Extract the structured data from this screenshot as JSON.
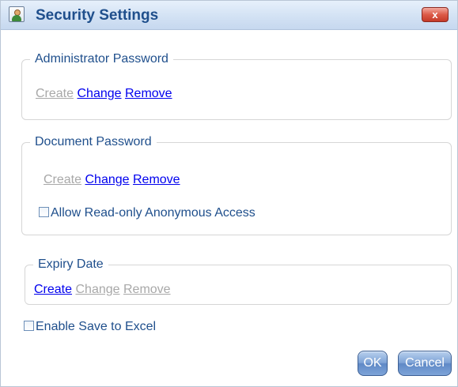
{
  "window": {
    "title": "Security Settings",
    "close_label": "x"
  },
  "admin_password": {
    "legend": "Administrator Password",
    "create": "Create",
    "change": "Change",
    "remove": "Remove"
  },
  "document_password": {
    "legend": "Document Password",
    "create": "Create",
    "change": "Change",
    "remove": "Remove",
    "allow_anonymous_label": "Allow Read-only Anonymous Access",
    "allow_anonymous_checked": false
  },
  "expiry_date": {
    "legend": "Expiry Date",
    "create": "Create",
    "change": "Change",
    "remove": "Remove"
  },
  "enable_save_to_excel": {
    "label": "Enable Save to Excel",
    "checked": false
  },
  "buttons": {
    "ok": "OK",
    "cancel": "Cancel"
  },
  "colors": {
    "title_text": "#1f4f8c",
    "link_active": "#0000ee",
    "link_disabled": "#a8a8a8",
    "close_button": "#dc5b48",
    "button_blue": "#6f96cf"
  },
  "icons": {
    "title": "security-user-icon",
    "close": "close-icon"
  }
}
